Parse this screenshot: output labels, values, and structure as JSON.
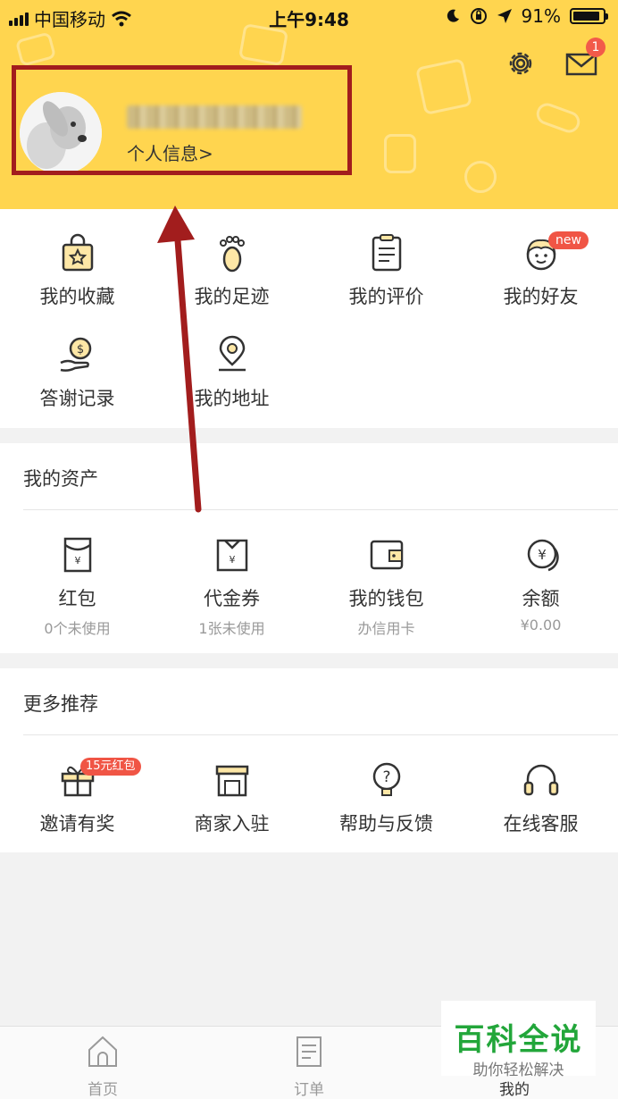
{
  "status_bar": {
    "carrier": "中国移动",
    "time": "上午9:48",
    "battery": "91%",
    "battery_level": 0.91
  },
  "header": {
    "settings_icon": "gear-icon",
    "mail_icon": "mail-icon",
    "mail_badge": "1",
    "profile_link": "个人信息>",
    "bg_color": "#ffd54f"
  },
  "shortcuts": [
    {
      "label": "我的收藏",
      "icon": "bag-star-icon"
    },
    {
      "label": "我的足迹",
      "icon": "footprint-icon"
    },
    {
      "label": "我的评价",
      "icon": "clipboard-icon"
    },
    {
      "label": "我的好友",
      "icon": "friend-face-icon",
      "badge": "new"
    },
    {
      "label": "答谢记录",
      "icon": "hand-coin-icon"
    },
    {
      "label": "我的地址",
      "icon": "location-pin-icon"
    }
  ],
  "assets": {
    "title": "我的资产",
    "items": [
      {
        "label": "红包",
        "sub": "0个未使用",
        "icon": "red-envelope-icon"
      },
      {
        "label": "代金券",
        "sub": "1张未使用",
        "icon": "voucher-icon"
      },
      {
        "label": "我的钱包",
        "sub": "办信用卡",
        "icon": "wallet-icon"
      },
      {
        "label": "余额",
        "sub": "¥0.00",
        "icon": "yuan-coin-icon"
      }
    ]
  },
  "more": {
    "title": "更多推荐",
    "items": [
      {
        "label": "邀请有奖",
        "icon": "gift-icon",
        "badge": "15元红包"
      },
      {
        "label": "商家入驻",
        "icon": "store-icon"
      },
      {
        "label": "帮助与反馈",
        "icon": "help-bulb-icon"
      },
      {
        "label": "在线客服",
        "icon": "headset-icon"
      }
    ]
  },
  "tabbar": [
    {
      "label": "首页",
      "icon": "home-icon"
    },
    {
      "label": "订单",
      "icon": "order-list-icon"
    },
    {
      "label": "我的",
      "icon": "profile-icon"
    }
  ],
  "watermark": {
    "title": "百科全说",
    "subtitle": "助你轻松解决"
  }
}
